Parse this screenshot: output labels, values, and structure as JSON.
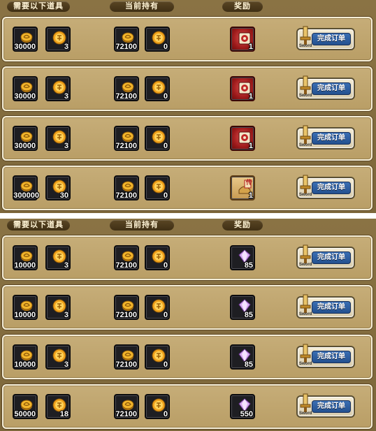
{
  "headers": {
    "required": "需要以下道具",
    "held": "当前持有",
    "reward": "奖励"
  },
  "button_label": "完成订单",
  "button_tag": "Sword",
  "panel1": [
    {
      "req_gold": "30000",
      "req_token": "3",
      "held_gold": "72100",
      "held_token": "0",
      "reward_count": "1",
      "reward_icon": "red-box-icon"
    },
    {
      "req_gold": "30000",
      "req_token": "3",
      "held_gold": "72100",
      "held_token": "0",
      "reward_count": "1",
      "reward_icon": "red-box-icon"
    },
    {
      "req_gold": "30000",
      "req_token": "3",
      "held_gold": "72100",
      "held_token": "0",
      "reward_count": "1",
      "reward_icon": "red-box-icon"
    },
    {
      "req_gold": "300000",
      "req_token": "30",
      "held_gold": "72100",
      "held_token": "0",
      "reward_count": "1",
      "reward_icon": "legend-scroll-icon",
      "reward_glyph": "传"
    }
  ],
  "panel2": [
    {
      "req_gold": "10000",
      "req_token": "3",
      "held_gold": "72100",
      "held_token": "0",
      "reward_count": "85",
      "reward_icon": "purple-gem-icon"
    },
    {
      "req_gold": "10000",
      "req_token": "3",
      "held_gold": "72100",
      "held_token": "0",
      "reward_count": "85",
      "reward_icon": "purple-gem-icon"
    },
    {
      "req_gold": "10000",
      "req_token": "3",
      "held_gold": "72100",
      "held_token": "0",
      "reward_count": "85",
      "reward_icon": "purple-gem-icon"
    },
    {
      "req_gold": "50000",
      "req_token": "18",
      "held_gold": "72100",
      "held_token": "0",
      "reward_count": "550",
      "reward_icon": "purple-gem-icon"
    }
  ],
  "colors": {
    "panel": "#8a7344",
    "row": "#c6ad78",
    "button_blue": "#2d5fa3"
  }
}
